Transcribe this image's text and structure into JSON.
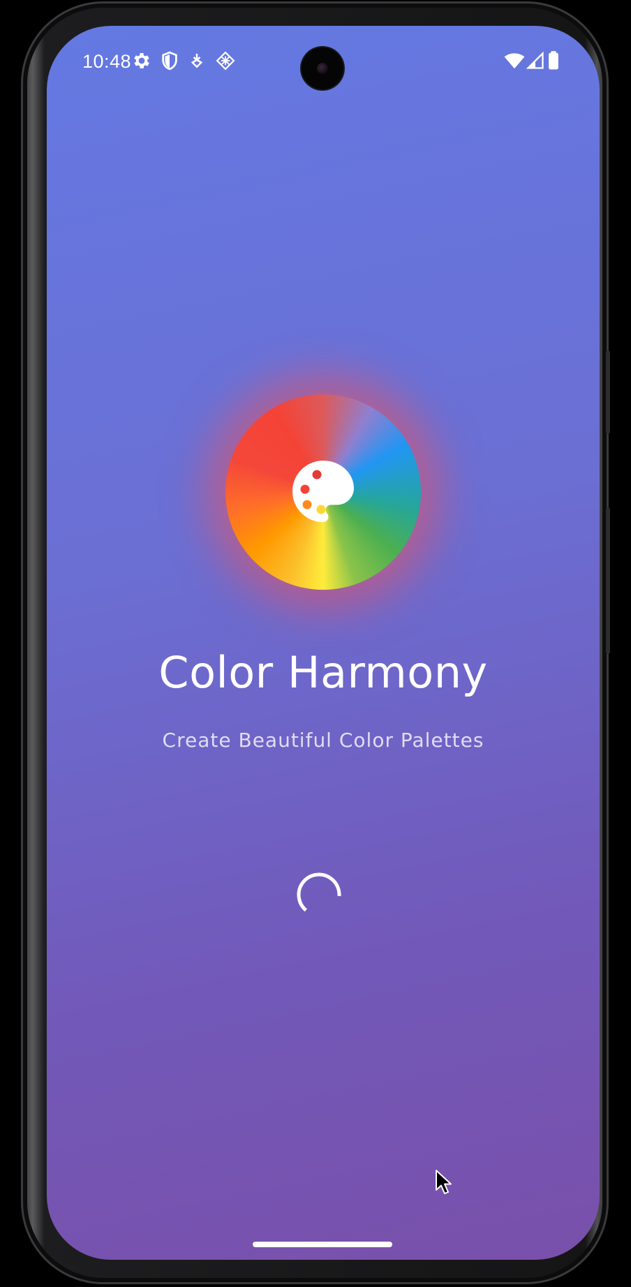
{
  "status_bar": {
    "time": "10:48",
    "left_icons": [
      "gear-icon",
      "shield-icon",
      "download-badge-icon",
      "diamond-grid-icon"
    ],
    "right_icons": [
      "wifi-icon",
      "cell-signal-icon",
      "battery-icon"
    ]
  },
  "splash": {
    "title": "Color Harmony",
    "subtitle": "Create Beautiful Color Palettes",
    "logo_icon": "palette-icon",
    "loading_indicator": "spinner"
  },
  "colors": {
    "background_top": "#6479e2",
    "background_bottom": "#7950aa",
    "text_primary": "#ffffff",
    "wheel_red": "#f44336",
    "wheel_blue": "#2196f3",
    "wheel_green": "#4caf50",
    "wheel_yellow": "#ffeb3b",
    "wheel_orange": "#ff9800"
  }
}
